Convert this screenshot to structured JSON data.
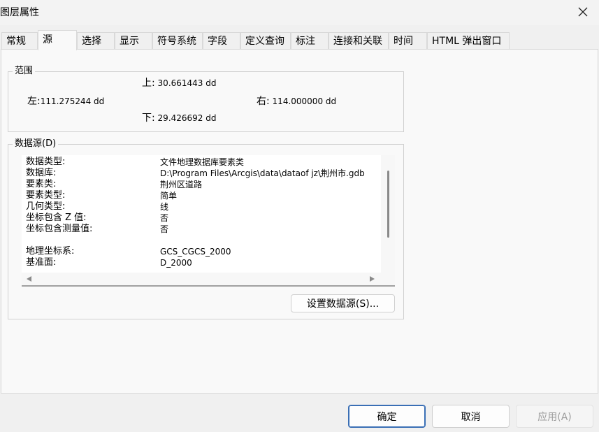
{
  "window": {
    "title": "图层属性"
  },
  "tabs": [
    {
      "label": "常规"
    },
    {
      "label": "源"
    },
    {
      "label": "选择"
    },
    {
      "label": "显示"
    },
    {
      "label": "符号系统"
    },
    {
      "label": "字段"
    },
    {
      "label": "定义查询"
    },
    {
      "label": "标注"
    },
    {
      "label": "连接和关联"
    },
    {
      "label": "时间"
    },
    {
      "label": "HTML 弹出窗口"
    }
  ],
  "active_tab": "源",
  "extent": {
    "legend": "范围",
    "top": {
      "label": "上:",
      "value": "30.661443 dd"
    },
    "left": {
      "label": "左:",
      "value": "111.275244 dd"
    },
    "right": {
      "label": "右:",
      "value": "114.000000 dd"
    },
    "bottom": {
      "label": "下:",
      "value": "29.426692 dd"
    }
  },
  "datasource": {
    "legend": "数据源(D)",
    "rows": [
      {
        "key": "数据类型:",
        "value": "文件地理数据库要素类"
      },
      {
        "key": "数据库:",
        "value": "D:\\Program Files\\Arcgis\\data\\dataof jz\\荆州市.gdb"
      },
      {
        "key": "要素类:",
        "value": "荆州区道路"
      },
      {
        "key": "要素类型:",
        "value": "简单"
      },
      {
        "key": "几何类型:",
        "value": "线"
      },
      {
        "key": "坐标包含 Z 值:",
        "value": "否"
      },
      {
        "key": "坐标包含测量值:",
        "value": "否"
      },
      {
        "key": "",
        "value": ""
      },
      {
        "key": "地理坐标系:",
        "value": "GCS_CGCS_2000"
      },
      {
        "key": "基准面:",
        "value": "D_2000"
      }
    ],
    "set_button": "设置数据源(S)..."
  },
  "footer": {
    "ok": "确定",
    "cancel": "取消",
    "apply": "应用(A)"
  }
}
